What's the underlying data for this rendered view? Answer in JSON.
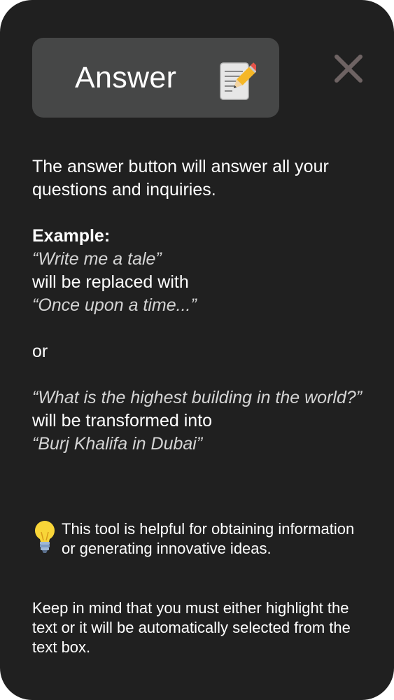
{
  "answer_button": {
    "label": "Answer",
    "icon": "memo-pencil-icon"
  },
  "close_button": {
    "icon": "close-icon",
    "color": "#6e6363"
  },
  "description": {
    "intro": "The answer button will answer all your questions and inquiries.",
    "example_heading": "Example:",
    "example1_input": "“Write me a tale”",
    "example1_connector": "will be replaced with",
    "example1_output": "“Once upon a time...”",
    "or": "or",
    "example2_input": "“What is the highest building in the world?”",
    "example2_connector": "will be transformed into",
    "example2_output": "“Burj Khalifa in Dubai”"
  },
  "tip": {
    "icon": "light-bulb-icon",
    "text": "This tool is helpful for obtaining information or generating innovative ideas."
  },
  "note": {
    "text": "Keep in mind that you must either highlight the text or it will be automatically selected from the text box."
  },
  "colors": {
    "panel_background": "#202020",
    "button_background": "#464747",
    "text": "#ffffff",
    "italic_text": "#d4d4d4"
  }
}
